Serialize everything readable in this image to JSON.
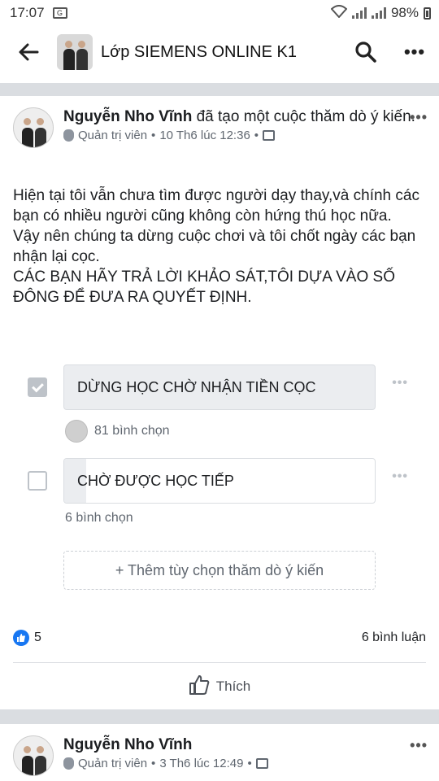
{
  "status_bar": {
    "time": "17:07",
    "battery": "98%"
  },
  "app_bar": {
    "title": "Lớp SIEMENS ONLINE K1"
  },
  "post": {
    "author": "Nguyễn Nho Vĩnh",
    "action": " đã tạo một cuộc thăm dò ý kiến.",
    "role": "Quản trị viên",
    "date": "10 Th6 lúc 12:36",
    "text": "Hiện tại tôi vẫn chưa tìm được người dạy thay,và chính các bạn có nhiều người cũng không còn hứng thú học nữa.\nVậy nên chúng ta dừng cuộc chơi và tôi chốt ngày các bạn nhận lại cọc.\nCÁC BẠN HÃY TRẢ LỜI KHẢO SÁT,TÔI DỰA VÀO SỐ ĐÔNG ĐỂ ĐƯA RA QUYẾT ĐỊNH.",
    "poll": {
      "options": [
        {
          "label": "DỪNG HỌC CHỜ NHẬN TIỀN CỌC",
          "votes_text": "81 bình chọn",
          "checked": true,
          "fraction": 0.93
        },
        {
          "label": "CHỜ ĐƯỢC HỌC TIẾP",
          "votes_text": "6 bình chọn",
          "checked": false,
          "fraction": 0.07
        }
      ],
      "add_option": "+ Thêm tùy chọn thăm dò ý kiến"
    },
    "likes": "5",
    "comments": "6 bình luận",
    "like_button": "Thích"
  },
  "next_post": {
    "author": "Nguyễn Nho Vĩnh",
    "role": "Quản trị viên",
    "date": "3 Th6 lúc 12:49"
  },
  "colors": {
    "accent": "#1877f2",
    "poll_fill": "#ebedf0",
    "divider": "#dadde1"
  }
}
